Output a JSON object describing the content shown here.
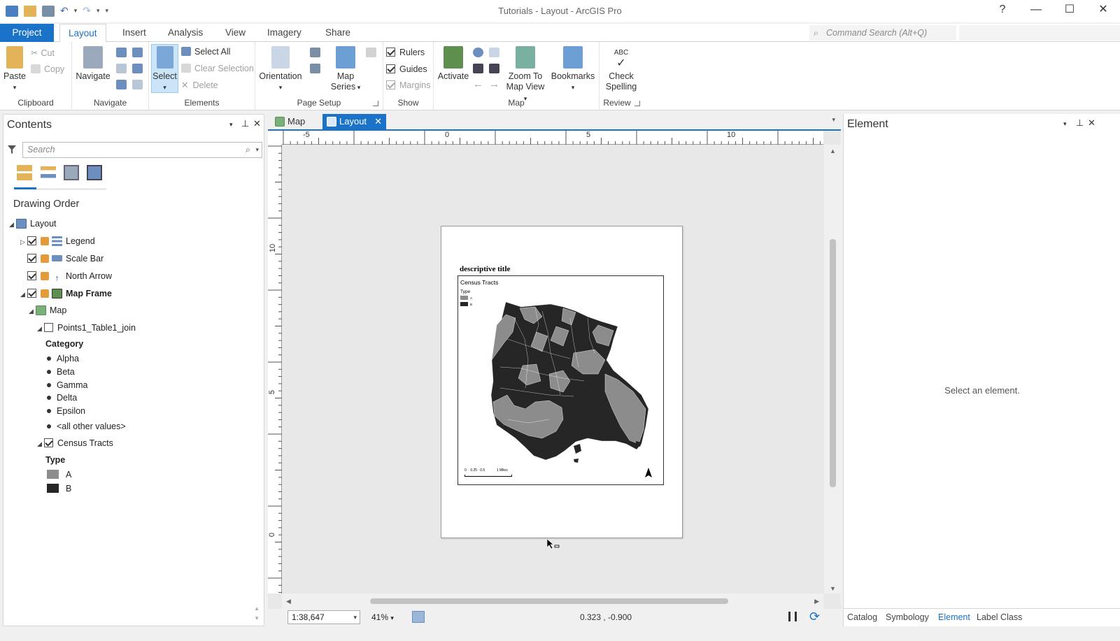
{
  "app": {
    "title": "Tutorials - Layout - ArcGIS Pro",
    "help": "?",
    "minimize": "—",
    "maximize": "☐",
    "close": "✕"
  },
  "ribbon_tabs": [
    "Project",
    "Layout",
    "Insert",
    "Analysis",
    "View",
    "Imagery",
    "Share"
  ],
  "command_search": {
    "placeholder": "Command Search (Alt+Q)"
  },
  "ribbon": {
    "clipboard": {
      "label": "Clipboard",
      "paste": "Paste",
      "cut": "Cut",
      "copy": "Copy"
    },
    "navigate": {
      "label": "Navigate",
      "navigate": "Navigate"
    },
    "elements": {
      "label": "Elements",
      "select": "Select",
      "select_all": "Select All",
      "clear_selection": "Clear Selection",
      "delete": "Delete"
    },
    "page_setup": {
      "label": "Page Setup",
      "orientation": "Orientation",
      "map_series_1": "Map",
      "map_series_2": "Series"
    },
    "show": {
      "label": "Show",
      "rulers": "Rulers",
      "guides": "Guides",
      "margins": "Margins"
    },
    "map": {
      "label": "Map",
      "activate": "Activate",
      "zoom_to_1": "Zoom To",
      "zoom_to_2": "Map View",
      "bookmarks": "Bookmarks"
    },
    "review": {
      "label": "Review",
      "check_1": "Check",
      "check_2": "Spelling",
      "abc": "ABC"
    }
  },
  "contents": {
    "title": "Contents",
    "search_placeholder": "Search",
    "drawing_order": "Drawing Order",
    "tree": {
      "layout": "Layout",
      "legend": "Legend",
      "scale_bar": "Scale Bar",
      "north_arrow": "North Arrow",
      "map_frame": "Map Frame",
      "map": "Map",
      "points_layer": "Points1_Table1_join",
      "category_heading": "Category",
      "categories": [
        "Alpha",
        "Beta",
        "Gamma",
        "Delta",
        "Epsilon",
        "<all other values>"
      ],
      "census_tracts": "Census Tracts",
      "type_heading": "Type",
      "type_a": "A",
      "type_b": "B"
    }
  },
  "view_tabs": {
    "map": "Map",
    "layout": "Layout"
  },
  "rulers": {
    "top": [
      "-5",
      "0",
      "5",
      "10"
    ],
    "left": [
      "10",
      "5",
      "0"
    ]
  },
  "page": {
    "title": "descriptive title",
    "legend_title": "Census Tracts",
    "legend_type": "Type",
    "legend_a": "A",
    "legend_b": "B",
    "scalebar_labels": "0    0.25   0.5            1 Miles"
  },
  "status": {
    "scale": "1:38,647",
    "zoom": "41%",
    "coords": "0.323 , -0.900"
  },
  "element_pane": {
    "title": "Element",
    "message": "Select an element.",
    "tabs": [
      "Catalog",
      "Symbology",
      "Element",
      "Label Class"
    ]
  },
  "colors": {
    "accent": "#1a73c9",
    "type_a": "#8c8c8c",
    "type_b": "#262626"
  }
}
